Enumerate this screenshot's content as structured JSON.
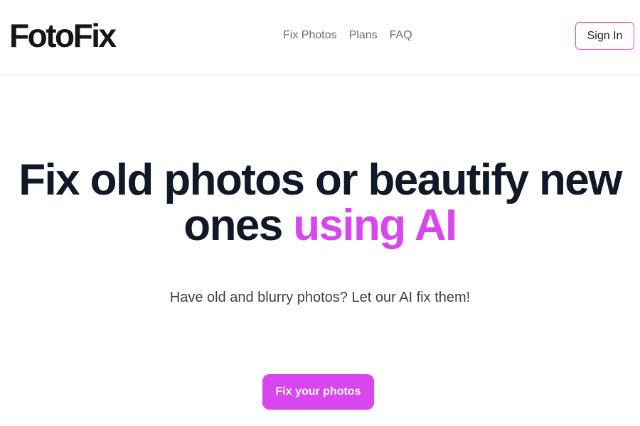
{
  "header": {
    "logo": "FotoFix",
    "nav": [
      "Fix Photos",
      "Plans",
      "FAQ"
    ],
    "sign_in_label": "Sign In"
  },
  "hero": {
    "headline_part1": "Fix old photos or beautify new ones ",
    "headline_accent": "using AI",
    "subtitle": "Have old and blurry photos? Let our AI fix them!",
    "cta_label": "Fix your photos"
  },
  "colors": {
    "accent": "#d946ef",
    "headline": "#111827",
    "nav_text": "#6b6b73",
    "background": "#ffffff"
  }
}
